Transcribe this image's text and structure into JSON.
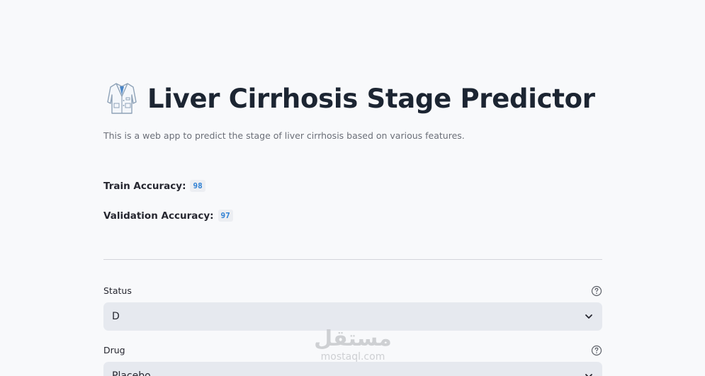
{
  "header": {
    "icon": "lab-coat-icon",
    "title": "Liver Cirrhosis Stage Predictor",
    "subtitle": "This is a web app to predict the stage of liver cirrhosis based on various features."
  },
  "metrics": {
    "train_label": "Train Accuracy:",
    "train_value": "98",
    "validation_label": "Validation Accuracy:",
    "validation_value": "97",
    "value_color": "#2d7fd3"
  },
  "form": {
    "status": {
      "label": "Status",
      "selected": "D",
      "help_icon": "question-circle-icon"
    },
    "drug": {
      "label": "Drug",
      "selected": "Placebo",
      "help_icon": "question-circle-icon"
    }
  },
  "watermark": {
    "arabic": "مستقل",
    "latin": "mostaql.com"
  },
  "colors": {
    "background": "#f8f9fb",
    "select_bg": "#e6e9ef",
    "title": "#1c2532"
  }
}
